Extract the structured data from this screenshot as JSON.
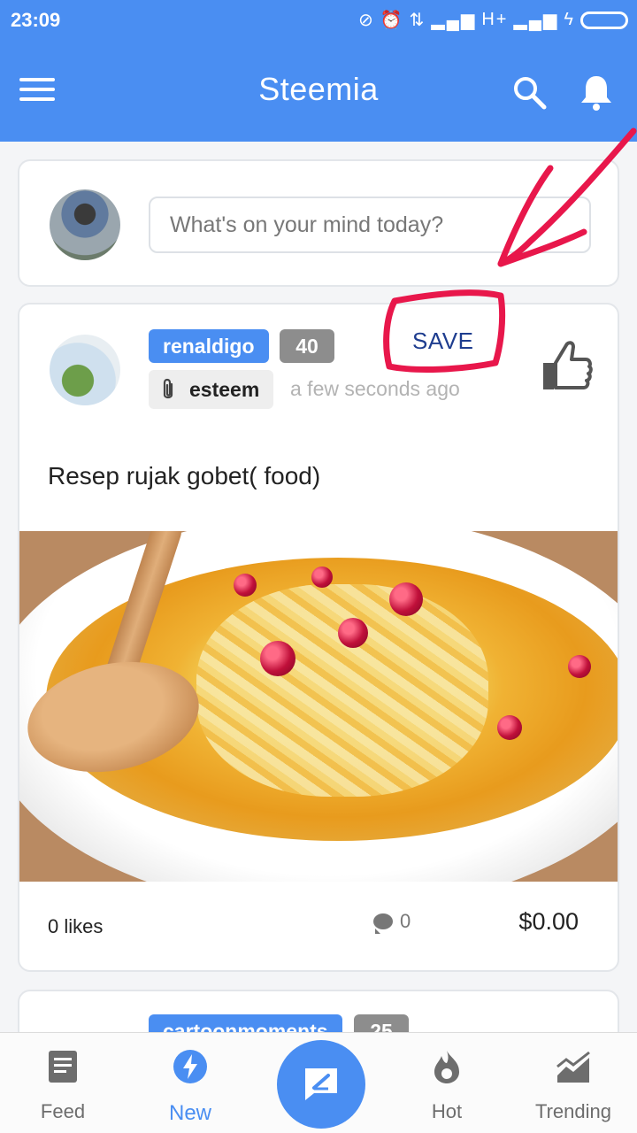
{
  "status_bar": {
    "time": "23:09",
    "icons": [
      "vibrate-off-icon",
      "alarm-icon",
      "data-transfer-icon",
      "signal-icon",
      "network-h-plus",
      "signal-icon",
      "charging-icon",
      "battery-icon"
    ],
    "network_label": "H+"
  },
  "appbar": {
    "title": "Steemia"
  },
  "composer": {
    "placeholder": "What's on your mind today?"
  },
  "post": {
    "author": "renaldigo",
    "reputation": "40",
    "app": "esteem",
    "time_ago": "a few seconds ago",
    "title": "Resep rujak gobet( food)",
    "likes": "0 likes",
    "comments": "0",
    "payout": "$0.00",
    "annotation_label": "SAVE"
  },
  "next_post": {
    "author": "cartoonmoments",
    "reputation": "25"
  },
  "bottom_nav": {
    "items": [
      {
        "label": "Feed",
        "active": false
      },
      {
        "label": "New",
        "active": true
      },
      {
        "label": "Hot",
        "active": false
      },
      {
        "label": "Trending",
        "active": false
      }
    ]
  },
  "colors": {
    "primary": "#4a8ef2",
    "annotation": "#e8174b",
    "badge_grey": "#8d8d8d"
  }
}
